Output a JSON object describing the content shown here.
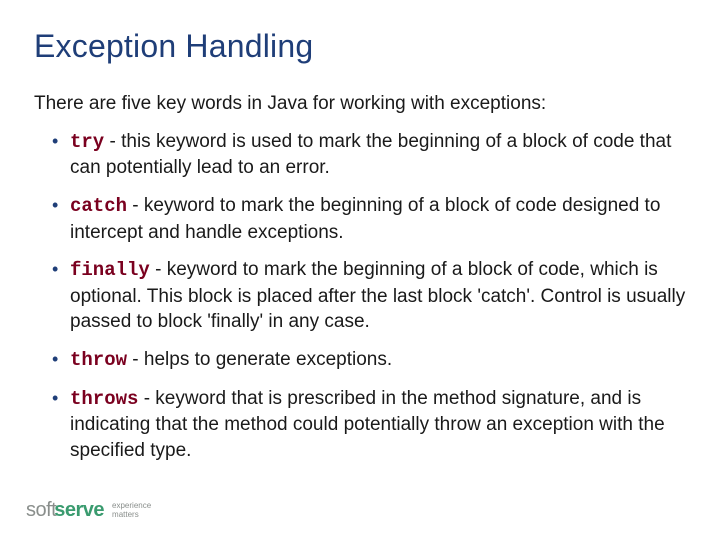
{
  "title": "Exception Handling",
  "intro": "There are five key words in Java for working with exceptions:",
  "items": [
    {
      "keyword": "try",
      "desc": " - this keyword is used to mark the beginning of a block of code that can potentially lead to an error."
    },
    {
      "keyword": "catch",
      "desc": " - keyword to mark the beginning of a block of code designed to intercept and handle exceptions."
    },
    {
      "keyword": "finally",
      "desc": " - keyword to mark the beginning of a block of code, which is optional. This block is placed after the last block 'catch'. Control is usually passed to block 'finally' in any case."
    },
    {
      "keyword": "throw",
      "desc": " - helps to generate exceptions."
    },
    {
      "keyword": "throws",
      "desc": " - keyword that is prescribed in the method signature, and is indicating that the method could potentially throw an exception with the specified type."
    }
  ],
  "logo": {
    "soft": "soft",
    "serve": "serve",
    "tag1": "experience",
    "tag2": "matters"
  }
}
